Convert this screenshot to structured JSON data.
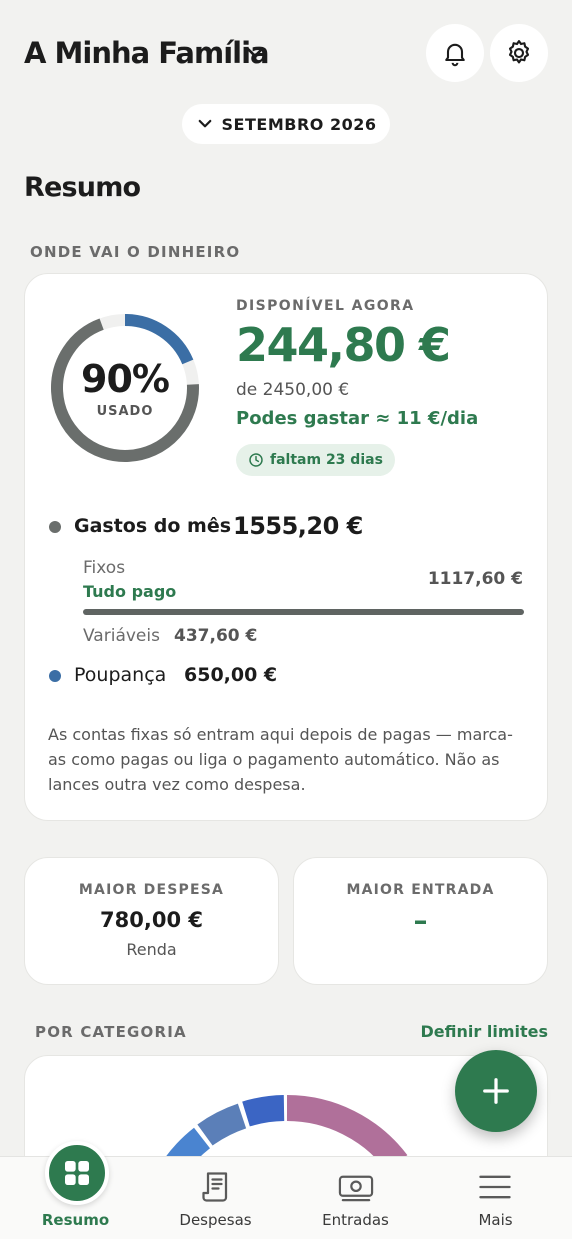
{
  "header": {
    "family_title": "A Minha Família",
    "month": "SETEMBRO 2026"
  },
  "summary": {
    "title": "Resumo",
    "money_section": "ONDE VAI O DINHEIRO",
    "usage": {
      "percent_label": "90%",
      "percent_used": 0.9,
      "sub": "USADO"
    },
    "available": {
      "label": "DISPONÍVEL AGORA",
      "amount": "244,80 €",
      "of_total": "de 2450,00 €",
      "per_day": "Podes gastar ≈ 11 €/dia",
      "days_left": "faltam 23 dias"
    },
    "spending": {
      "label": "Gastos do mês",
      "amount": "1555,20 €",
      "fixed_label": "Fixos",
      "fixed_status": "Tudo pago",
      "fixed_amount": "1117,60 €",
      "variable_label": "Variáveis",
      "variable_amount": "437,60 €"
    },
    "savings": {
      "label": "Poupança",
      "amount": "650,00 €"
    },
    "note": "As contas fixas só entram aqui depois de pagas — marca-as como pagas ou liga o pagamento automático. Não as lances outra vez como despesa."
  },
  "highlights": {
    "max_expense_label": "MAIOR DESPESA",
    "max_expense_amount": "780,00 €",
    "max_expense_category": "Renda",
    "max_income_label": "MAIOR ENTRADA",
    "max_income_value": "–"
  },
  "categories": {
    "title": "POR CATEGORIA",
    "set_limits": "Definir limites"
  },
  "nav": {
    "items": [
      {
        "label": "Resumo"
      },
      {
        "label": "Despesas"
      },
      {
        "label": "Entradas"
      },
      {
        "label": "Mais"
      }
    ]
  },
  "colors": {
    "brand_green": "#2e7a4f",
    "spending_gray": "#5f6462",
    "savings_blue": "#3b6ea5",
    "background": "#f2f2f0"
  },
  "icons": {
    "bell": "bell-icon",
    "settings": "gear-icon",
    "add": "plus-icon",
    "clock": "clock-icon"
  }
}
